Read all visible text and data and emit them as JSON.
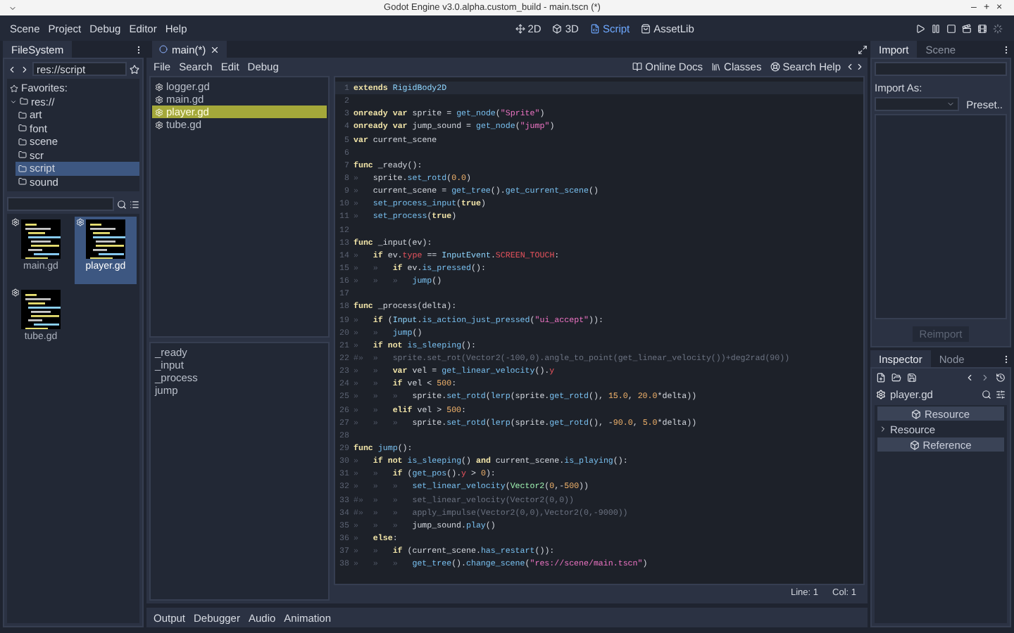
{
  "window": {
    "title": "Godot Engine v3.0.alpha.custom_build - main.tscn (*)",
    "controls": [
      "–",
      "+",
      "×"
    ]
  },
  "menu": [
    "Scene",
    "Project",
    "Debug",
    "Editor",
    "Help"
  ],
  "workspaces": [
    {
      "label": "2D",
      "selected": false
    },
    {
      "label": "3D",
      "selected": false
    },
    {
      "label": "Script",
      "selected": true
    },
    {
      "label": "AssetLib",
      "selected": false
    }
  ],
  "filesystem": {
    "tab": "FileSystem",
    "path": "res://script",
    "tree": [
      {
        "label": "Favorites:",
        "kind": "favorites"
      },
      {
        "label": "res://",
        "kind": "folder",
        "expanded": true,
        "selected": false,
        "children": [
          {
            "label": "art",
            "kind": "folder",
            "selected": false
          },
          {
            "label": "font",
            "kind": "folder",
            "selected": false
          },
          {
            "label": "scene",
            "kind": "folder",
            "selected": false
          },
          {
            "label": "scr",
            "kind": "folder",
            "selected": false
          },
          {
            "label": "script",
            "kind": "folder",
            "selected": true
          },
          {
            "label": "sound",
            "kind": "folder",
            "selected": false
          }
        ]
      }
    ],
    "files": [
      {
        "name": "main.gd",
        "selected": false
      },
      {
        "name": "player.gd",
        "selected": true
      },
      {
        "name": "tube.gd",
        "selected": false
      }
    ]
  },
  "script_tab": {
    "label": "main(*)"
  },
  "script_menu": [
    "File",
    "Search",
    "Edit",
    "Debug"
  ],
  "help_links": [
    "Online Docs",
    "Classes",
    "Search Help"
  ],
  "scripts": [
    {
      "name": "logger.gd",
      "selected": false
    },
    {
      "name": "main.gd",
      "selected": false
    },
    {
      "name": "player.gd",
      "selected": true
    },
    {
      "name": "tube.gd",
      "selected": false
    }
  ],
  "functions": [
    "_ready",
    "_input",
    "_process",
    "jump"
  ],
  "code": [
    {
      "n": "1",
      "kind": "code",
      "segs": [
        {
          "kind": "keyword",
          "text": "extends"
        },
        {
          "kind": "type",
          "text": " RigidBody2D"
        }
      ]
    },
    {
      "n": "2",
      "kind": "code"
    },
    {
      "n": "3",
      "kind": "code",
      "segs": [
        {
          "kind": "keyword",
          "text": "onready"
        },
        {
          "kind": "keyword",
          "text": " var"
        },
        {
          "kind": "plain",
          "text": " sprite = "
        },
        {
          "kind": "function",
          "text": "get_node"
        },
        {
          "kind": "plain",
          "text": "("
        },
        {
          "kind": "string",
          "text": "\"Sprite\""
        },
        {
          "kind": "plain",
          "text": ")"
        }
      ]
    },
    {
      "n": "4",
      "kind": "code",
      "segs": [
        {
          "kind": "keyword",
          "text": "onready"
        },
        {
          "kind": "keyword",
          "text": " var"
        },
        {
          "kind": "plain",
          "text": " jump_sound = "
        },
        {
          "kind": "function",
          "text": "get_node"
        },
        {
          "kind": "plain",
          "text": "("
        },
        {
          "kind": "string",
          "text": "\"jump\""
        },
        {
          "kind": "plain",
          "text": ")"
        }
      ]
    },
    {
      "n": "5",
      "kind": "code",
      "segs": [
        {
          "kind": "keyword",
          "text": "var"
        },
        {
          "kind": "plain",
          "text": " current_scene"
        }
      ]
    },
    {
      "n": "6",
      "kind": "code"
    },
    {
      "n": "7",
      "kind": "code",
      "segs": [
        {
          "kind": "keyword",
          "text": "func"
        },
        {
          "kind": "plain",
          "text": " _ready():"
        }
      ]
    },
    {
      "n": "8",
      "kind": "code",
      "indent": [
        "»"
      ],
      "segs": [
        {
          "kind": "plain",
          "text": "sprite."
        },
        {
          "kind": "function",
          "text": "set_rotd"
        },
        {
          "kind": "plain",
          "text": "("
        },
        {
          "kind": "number",
          "text": "0.0"
        },
        {
          "kind": "plain",
          "text": ")"
        }
      ]
    },
    {
      "n": "9",
      "kind": "code",
      "indent": [
        "»"
      ],
      "segs": [
        {
          "kind": "plain",
          "text": "current_scene = "
        },
        {
          "kind": "function",
          "text": "get_tree"
        },
        {
          "kind": "plain",
          "text": "()."
        },
        {
          "kind": "function",
          "text": "get_current_scene"
        },
        {
          "kind": "plain",
          "text": "()"
        }
      ]
    },
    {
      "n": "10",
      "kind": "code",
      "indent": [
        "»"
      ],
      "segs": [
        {
          "kind": "function",
          "text": "set_process_input"
        },
        {
          "kind": "plain",
          "text": "("
        },
        {
          "kind": "keyword",
          "text": "true"
        },
        {
          "kind": "plain",
          "text": ")"
        }
      ]
    },
    {
      "n": "11",
      "kind": "code",
      "indent": [
        "»"
      ],
      "segs": [
        {
          "kind": "function",
          "text": "set_process"
        },
        {
          "kind": "plain",
          "text": "("
        },
        {
          "kind": "keyword",
          "text": "true"
        },
        {
          "kind": "plain",
          "text": ")"
        }
      ]
    },
    {
      "n": "12",
      "kind": "code"
    },
    {
      "n": "13",
      "kind": "code",
      "segs": [
        {
          "kind": "keyword",
          "text": "func"
        },
        {
          "kind": "plain",
          "text": " _input(ev):"
        }
      ]
    },
    {
      "n": "14",
      "kind": "code",
      "indent": [
        "»"
      ],
      "segs": [
        {
          "kind": "keyword",
          "text": "if"
        },
        {
          "kind": "plain",
          "text": " ev."
        },
        {
          "kind": "member",
          "text": "type"
        },
        {
          "kind": "plain",
          "text": " == "
        },
        {
          "kind": "type",
          "text": "InputEvent"
        },
        {
          "kind": "plain",
          "text": "."
        },
        {
          "kind": "member",
          "text": "SCREEN_TOUCH"
        },
        {
          "kind": "plain",
          "text": ":"
        }
      ]
    },
    {
      "n": "15",
      "kind": "code",
      "indent": [
        "»",
        "»"
      ],
      "segs": [
        {
          "kind": "keyword",
          "text": "if"
        },
        {
          "kind": "plain",
          "text": " ev."
        },
        {
          "kind": "function",
          "text": "is_pressed"
        },
        {
          "kind": "plain",
          "text": "():"
        }
      ]
    },
    {
      "n": "16",
      "kind": "code",
      "indent": [
        "»",
        "»",
        "»"
      ],
      "segs": [
        {
          "kind": "function",
          "text": "jump"
        },
        {
          "kind": "plain",
          "text": "()"
        }
      ]
    },
    {
      "n": "17",
      "kind": "code"
    },
    {
      "n": "18",
      "kind": "code",
      "segs": [
        {
          "kind": "keyword",
          "text": "func"
        },
        {
          "kind": "plain",
          "text": " _process(delta):"
        }
      ]
    },
    {
      "n": "19",
      "kind": "code",
      "indent": [
        "»"
      ],
      "segs": [
        {
          "kind": "keyword",
          "text": "if"
        },
        {
          "kind": "plain",
          "text": " ("
        },
        {
          "kind": "type",
          "text": "Input"
        },
        {
          "kind": "plain",
          "text": "."
        },
        {
          "kind": "function",
          "text": "is_action_just_pressed"
        },
        {
          "kind": "plain",
          "text": "("
        },
        {
          "kind": "string",
          "text": "\"ui_accept\""
        },
        {
          "kind": "plain",
          "text": ")):"
        }
      ]
    },
    {
      "n": "20",
      "kind": "code",
      "indent": [
        "»",
        "»"
      ],
      "segs": [
        {
          "kind": "function",
          "text": "jump"
        },
        {
          "kind": "plain",
          "text": "()"
        }
      ]
    },
    {
      "n": "21",
      "kind": "code",
      "indent": [
        "»"
      ],
      "segs": [
        {
          "kind": "keyword",
          "text": "if"
        },
        {
          "kind": "keyword",
          "text": " not"
        },
        {
          "kind": "function",
          "text": " is_sleeping"
        },
        {
          "kind": "plain",
          "text": "():"
        }
      ]
    },
    {
      "n": "22",
      "kind": "comment",
      "indent": [
        "#»",
        "»"
      ],
      "text": "sprite.set_rot(Vector2(-100,0).angle_to_point(get_linear_velocity())+deg2rad(90))"
    },
    {
      "n": "23",
      "kind": "code",
      "indent": [
        "»",
        "»"
      ],
      "segs": [
        {
          "kind": "keyword",
          "text": "var"
        },
        {
          "kind": "plain",
          "text": " vel = "
        },
        {
          "kind": "function",
          "text": "get_linear_velocity"
        },
        {
          "kind": "plain",
          "text": "()."
        },
        {
          "kind": "member",
          "text": "y"
        }
      ]
    },
    {
      "n": "24",
      "kind": "code",
      "indent": [
        "»",
        "»"
      ],
      "segs": [
        {
          "kind": "keyword",
          "text": "if"
        },
        {
          "kind": "plain",
          "text": " vel < "
        },
        {
          "kind": "number",
          "text": "500"
        },
        {
          "kind": "plain",
          "text": ":"
        }
      ]
    },
    {
      "n": "25",
      "kind": "code",
      "indent": [
        "»",
        "»",
        "»"
      ],
      "segs": [
        {
          "kind": "plain",
          "text": "sprite."
        },
        {
          "kind": "function",
          "text": "set_rotd"
        },
        {
          "kind": "plain",
          "text": "("
        },
        {
          "kind": "function",
          "text": "lerp"
        },
        {
          "kind": "plain",
          "text": "(sprite."
        },
        {
          "kind": "function",
          "text": "get_rotd"
        },
        {
          "kind": "plain",
          "text": "(), "
        },
        {
          "kind": "number",
          "text": "15.0"
        },
        {
          "kind": "plain",
          "text": ", "
        },
        {
          "kind": "number",
          "text": "20.0"
        },
        {
          "kind": "plain",
          "text": "*delta))"
        }
      ]
    },
    {
      "n": "26",
      "kind": "code",
      "indent": [
        "»",
        "»"
      ],
      "segs": [
        {
          "kind": "keyword",
          "text": "elif"
        },
        {
          "kind": "plain",
          "text": " vel > "
        },
        {
          "kind": "number",
          "text": "500"
        },
        {
          "kind": "plain",
          "text": ":"
        }
      ]
    },
    {
      "n": "27",
      "kind": "code",
      "indent": [
        "»",
        "»",
        "»"
      ],
      "segs": [
        {
          "kind": "plain",
          "text": "sprite."
        },
        {
          "kind": "function",
          "text": "set_rotd"
        },
        {
          "kind": "plain",
          "text": "("
        },
        {
          "kind": "function",
          "text": "lerp"
        },
        {
          "kind": "plain",
          "text": "(sprite."
        },
        {
          "kind": "function",
          "text": "get_rotd"
        },
        {
          "kind": "plain",
          "text": "(), -"
        },
        {
          "kind": "number",
          "text": "90.0"
        },
        {
          "kind": "plain",
          "text": ", "
        },
        {
          "kind": "number",
          "text": "5.0"
        },
        {
          "kind": "plain",
          "text": "*delta))"
        }
      ]
    },
    {
      "n": "28",
      "kind": "code"
    },
    {
      "n": "29",
      "kind": "code",
      "segs": [
        {
          "kind": "keyword",
          "text": "func"
        },
        {
          "kind": "function",
          "text": " jump"
        },
        {
          "kind": "plain",
          "text": "():"
        }
      ]
    },
    {
      "n": "30",
      "kind": "code",
      "indent": [
        "»"
      ],
      "segs": [
        {
          "kind": "keyword",
          "text": "if"
        },
        {
          "kind": "keyword",
          "text": " not"
        },
        {
          "kind": "function",
          "text": " is_sleeping"
        },
        {
          "kind": "plain",
          "text": "()"
        },
        {
          "kind": "keyword",
          "text": " and"
        },
        {
          "kind": "plain",
          "text": " current_scene."
        },
        {
          "kind": "function",
          "text": "is_playing"
        },
        {
          "kind": "plain",
          "text": "():"
        }
      ]
    },
    {
      "n": "31",
      "kind": "code",
      "indent": [
        "»",
        "»"
      ],
      "segs": [
        {
          "kind": "keyword",
          "text": "if"
        },
        {
          "kind": "plain",
          "text": " ("
        },
        {
          "kind": "function",
          "text": "get_pos"
        },
        {
          "kind": "plain",
          "text": "()."
        },
        {
          "kind": "member",
          "text": "y"
        },
        {
          "kind": "plain",
          "text": " > "
        },
        {
          "kind": "number",
          "text": "0"
        },
        {
          "kind": "plain",
          "text": "):"
        }
      ]
    },
    {
      "n": "32",
      "kind": "code",
      "indent": [
        "»",
        "»",
        "»"
      ],
      "segs": [
        {
          "kind": "function",
          "text": "set_linear_velocity"
        },
        {
          "kind": "plain",
          "text": "("
        },
        {
          "kind": "class",
          "text": "Vector2"
        },
        {
          "kind": "plain",
          "text": "("
        },
        {
          "kind": "number",
          "text": "0"
        },
        {
          "kind": "plain",
          "text": ",-"
        },
        {
          "kind": "number",
          "text": "500"
        },
        {
          "kind": "plain",
          "text": "))"
        }
      ]
    },
    {
      "n": "33",
      "kind": "comment",
      "indent": [
        "#»",
        "»",
        "»"
      ],
      "text": "set_linear_velocity(Vector2(0,0))"
    },
    {
      "n": "34",
      "kind": "comment",
      "indent": [
        "#»",
        "»",
        "»"
      ],
      "text": "apply_impulse(Vector2(0,0),Vector2(0,-9000))"
    },
    {
      "n": "35",
      "kind": "code",
      "indent": [
        "»",
        "»",
        "»"
      ],
      "segs": [
        {
          "kind": "plain",
          "text": "jump_sound."
        },
        {
          "kind": "function",
          "text": "play"
        },
        {
          "kind": "plain",
          "text": "()"
        }
      ]
    },
    {
      "n": "36",
      "kind": "code",
      "indent": [
        "»"
      ],
      "segs": [
        {
          "kind": "keyword",
          "text": "else"
        },
        {
          "kind": "plain",
          "text": ":"
        }
      ]
    },
    {
      "n": "37",
      "kind": "code",
      "indent": [
        "»",
        "»"
      ],
      "segs": [
        {
          "kind": "keyword",
          "text": "if"
        },
        {
          "kind": "plain",
          "text": " (current_scene."
        },
        {
          "kind": "function",
          "text": "has_restart"
        },
        {
          "kind": "plain",
          "text": "()):"
        }
      ]
    },
    {
      "n": "38",
      "kind": "code",
      "indent": [
        "»",
        "»",
        "»"
      ],
      "segs": [
        {
          "kind": "function",
          "text": "get_tree"
        },
        {
          "kind": "plain",
          "text": "()."
        },
        {
          "kind": "function",
          "text": "change_scene"
        },
        {
          "kind": "plain",
          "text": "("
        },
        {
          "kind": "string",
          "text": "\"res://scene/main.tscn\""
        },
        {
          "kind": "plain",
          "text": ")"
        }
      ]
    }
  ],
  "status": {
    "line": "Line: 1",
    "col": "Col: 1"
  },
  "bottom_tabs": [
    "Output",
    "Debugger",
    "Audio",
    "Animation"
  ],
  "import_dock": {
    "tabs": [
      {
        "label": "Import",
        "selected": true
      },
      {
        "label": "Scene",
        "selected": false
      }
    ],
    "import_as": "Import As:",
    "preset": "Preset..",
    "reimport": {
      "label": "Reimport",
      "disabled": true
    }
  },
  "inspector": {
    "tabs": [
      {
        "label": "Inspector",
        "selected": true
      },
      {
        "label": "Node",
        "selected": false
      }
    ],
    "object": "player.gd",
    "sections": [
      {
        "kind": "header",
        "label": "Resource"
      },
      {
        "kind": "group",
        "label": "Resource",
        "expanded": false
      },
      {
        "kind": "header",
        "label": "Reference"
      }
    ]
  }
}
